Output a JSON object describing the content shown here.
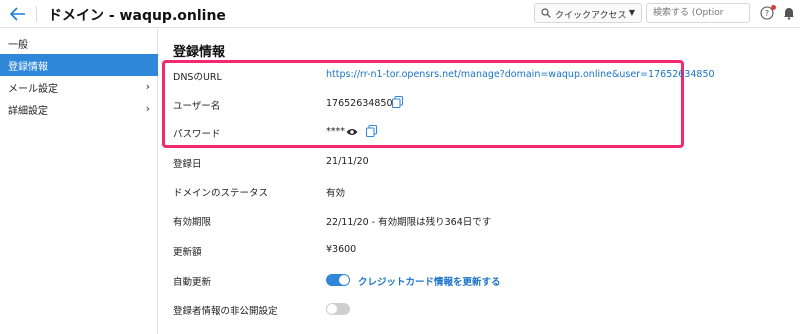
{
  "header": {
    "back_icon": "back-arrow-icon",
    "title": "ドメイン - waqup.online",
    "quick_access_label": "クイックアクセス",
    "search_placeholder": "検索する (Optior",
    "accent": "#1e7ed8"
  },
  "sidebar": {
    "items": [
      {
        "label": "一般",
        "chevron": false,
        "active": false
      },
      {
        "label": "登録情報",
        "chevron": false,
        "active": true
      },
      {
        "label": "メール設定",
        "chevron": true,
        "active": false
      },
      {
        "label": "詳細設定",
        "chevron": true,
        "active": false
      }
    ],
    "active_color": "#2f87da"
  },
  "main": {
    "section_title": "登録情報",
    "highlight_color": "#f2296f",
    "rows": [
      {
        "label": "DNSのURL",
        "value": "https://rr-n1-tor.opensrs.net/manage?domain=waqup.online&user=17652634850"
      },
      {
        "label": "ユーザー名",
        "value": "17652634850"
      },
      {
        "label": "パスワード",
        "value": "****"
      },
      {
        "label": "登録日",
        "value": "21/11/20"
      },
      {
        "label": "ドメインのステータス",
        "value": "有効"
      },
      {
        "label": "有効期限",
        "value": "22/11/20 - 有効期限は残り364日です"
      },
      {
        "label": "更新額",
        "value": "¥3600"
      },
      {
        "label": "自動更新",
        "value": "クレジットカード情報を更新する",
        "toggle": true
      },
      {
        "label": "登録者情報の非公開設定",
        "value": "",
        "toggle": false
      }
    ]
  }
}
